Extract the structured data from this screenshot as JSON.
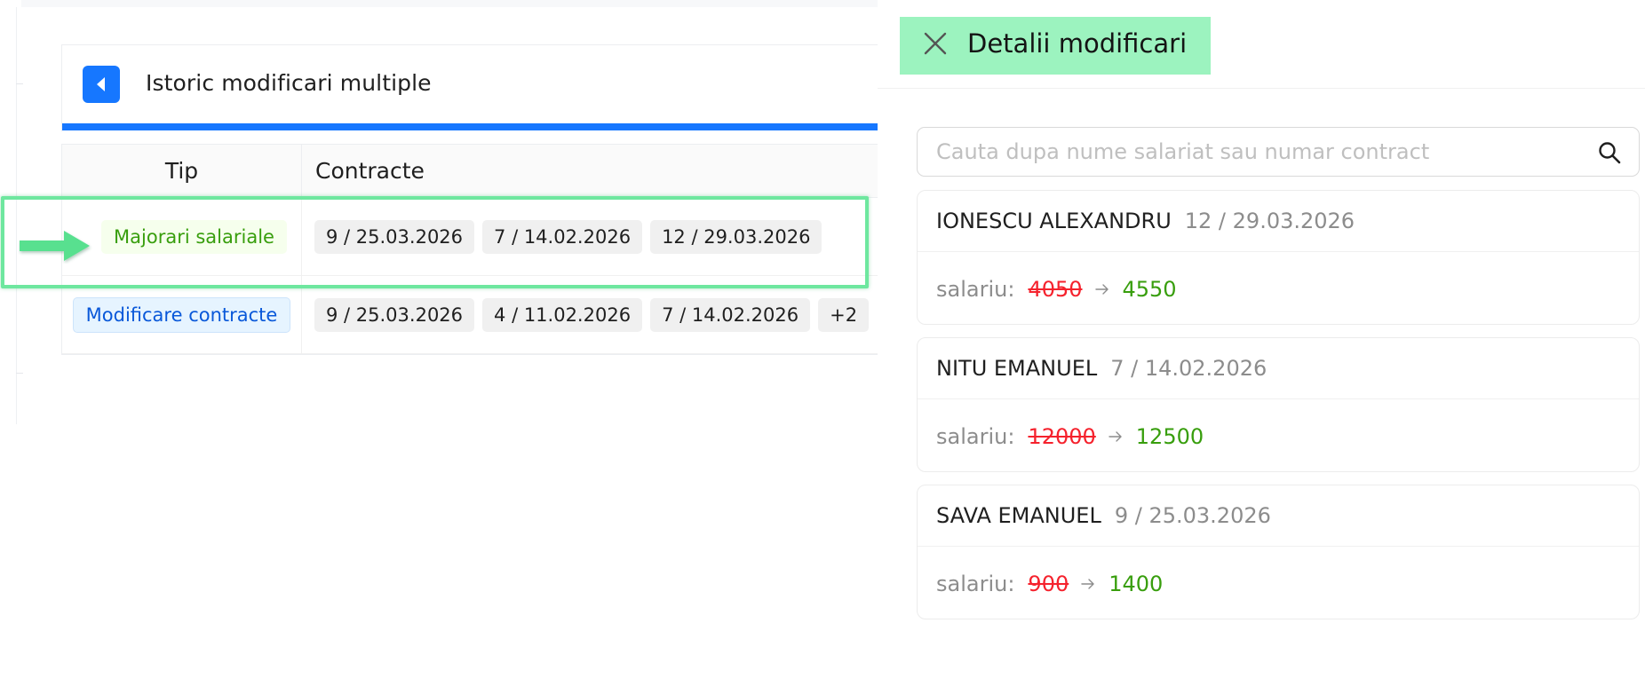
{
  "history": {
    "title": "Istoric modificari multiple",
    "columns": {
      "tip": "Tip",
      "contracte": "Contracte"
    },
    "rows": [
      {
        "type": "Majorari salariale",
        "contracts": [
          "9 / 25.03.2026",
          "7 / 14.02.2026",
          "12 / 29.03.2026"
        ]
      },
      {
        "type": "Modificare contracte",
        "contracts": [
          "9 / 25.03.2026",
          "4 / 11.02.2026",
          "7 / 14.02.2026"
        ],
        "more": "+2"
      }
    ]
  },
  "drawer": {
    "title": "Detalii modificari",
    "search": {
      "placeholder": "Cauta dupa nume salariat sau numar contract",
      "value": ""
    },
    "employees": [
      {
        "name": "IONESCU ALEXANDRU",
        "contract": "12 / 29.03.2026",
        "field": "salariu:",
        "old": "4050",
        "new": "4550"
      },
      {
        "name": "NITU EMANUEL",
        "contract": "7 / 14.02.2026",
        "field": "salariu:",
        "old": "12000",
        "new": "12500"
      },
      {
        "name": "SAVA EMANUEL",
        "contract": "9 / 25.03.2026",
        "field": "salariu:",
        "old": "900",
        "new": "1400"
      }
    ]
  },
  "colors": {
    "primary": "#1677ff",
    "highlight": "#6ee79f",
    "header_highlight": "#9cf3bf",
    "old_value": "#f5222d",
    "new_value": "#389e0d"
  },
  "icons": {
    "back": "caret-left-icon",
    "close": "close-icon",
    "search": "search-icon",
    "change": "arrow-right-icon",
    "annotation": "annotation-arrow-icon"
  }
}
